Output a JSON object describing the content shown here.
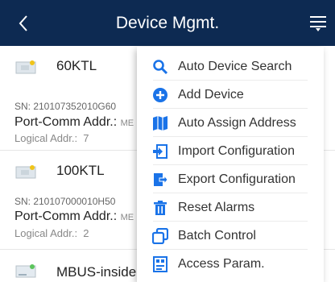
{
  "header": {
    "title": "Device Mgmt.",
    "back_icon": "chevron-left-icon",
    "menu_icon": "filter-menu-icon"
  },
  "devices": [
    {
      "name": "60KTL",
      "sn": "SN:  210107352010G60",
      "port_label": "Port-Comm Addr.:",
      "port_value": "ME",
      "logical_label": "Logical Addr.:",
      "logical_value": "7",
      "icon": "inverter-icon"
    },
    {
      "name": "100KTL",
      "sn": "SN:  210107000010H50",
      "port_label": "Port-Comm Addr.:",
      "port_value": "ME",
      "logical_label": "Logical Addr.:",
      "logical_value": "2",
      "icon": "inverter-icon"
    },
    {
      "name": "MBUS-inside",
      "icon": "mbus-device-icon"
    }
  ],
  "menu": {
    "items": [
      {
        "label": "Auto Device Search",
        "icon": "search-icon"
      },
      {
        "label": "Add Device",
        "icon": "plus-circle-icon"
      },
      {
        "label": "Auto Assign Address",
        "icon": "map-icon"
      },
      {
        "label": "Import Configuration",
        "icon": "import-icon"
      },
      {
        "label": "Export Configuration",
        "icon": "export-icon"
      },
      {
        "label": "Reset Alarms",
        "icon": "trash-icon"
      },
      {
        "label": "Batch Control",
        "icon": "batch-icon"
      },
      {
        "label": "Access Param.",
        "icon": "access-icon"
      }
    ]
  },
  "colors": {
    "header_bg": "#0d2a52",
    "accent": "#1a73e8",
    "text": "#333333"
  }
}
